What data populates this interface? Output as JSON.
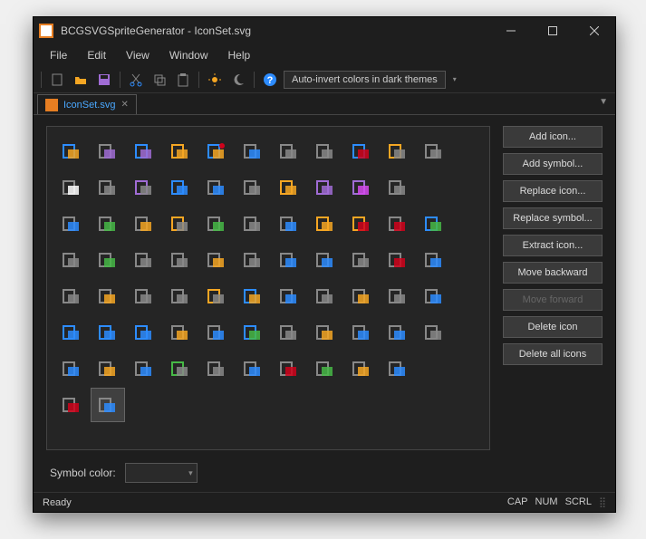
{
  "window": {
    "title": "BCGSVGSpriteGenerator - IconSet.svg"
  },
  "menubar": {
    "items": [
      "File",
      "Edit",
      "View",
      "Window",
      "Help"
    ]
  },
  "toolbar": {
    "auto_invert_label": "Auto-invert colors in dark themes"
  },
  "tab": {
    "label": "IconSet.svg"
  },
  "sidebar": {
    "buttons": [
      {
        "label": "Add icon...",
        "enabled": true
      },
      {
        "label": "Add symbol...",
        "enabled": true
      },
      {
        "label": "Replace icon...",
        "enabled": true
      },
      {
        "label": "Replace symbol...",
        "enabled": true
      },
      {
        "label": "Extract icon...",
        "enabled": true
      },
      {
        "label": "Move backward",
        "enabled": true
      },
      {
        "label": "Move forward",
        "enabled": false
      },
      {
        "label": "Delete icon",
        "enabled": true
      },
      {
        "label": "Delete all icons",
        "enabled": true
      }
    ]
  },
  "bottom": {
    "symbol_color_label": "Symbol color:"
  },
  "status": {
    "left": "Ready",
    "cap": "CAP",
    "num": "NUM",
    "scrl": "SCRL"
  },
  "icons": [
    {
      "name": "bar-chart",
      "c": [
        "#2d8cff",
        "#f5a623"
      ]
    },
    {
      "name": "chart-table",
      "c": [
        "#888",
        "#a06cd5"
      ]
    },
    {
      "name": "bars-arrow",
      "c": [
        "#2d8cff",
        "#a06cd5"
      ]
    },
    {
      "name": "sun",
      "c": [
        "#f5a623"
      ]
    },
    {
      "name": "pie-chart",
      "c": [
        "#2d8cff",
        "#f5a623",
        "#d0021b"
      ]
    },
    {
      "name": "image-resize",
      "c": [
        "#888",
        "#2d8cff"
      ]
    },
    {
      "name": "windows",
      "c": [
        "#888"
      ]
    },
    {
      "name": "align-left",
      "c": [
        "#888"
      ]
    },
    {
      "name": "font-a",
      "c": [
        "#2d8cff",
        "#d0021b"
      ]
    },
    {
      "name": "square-back",
      "c": [
        "#f5a623",
        "#888"
      ]
    },
    {
      "name": "squares",
      "c": [
        "#888"
      ]
    },
    {
      "name": "contrast",
      "c": [
        "#888",
        "#fff"
      ]
    },
    {
      "name": "sun-outline",
      "c": [
        "#888"
      ]
    },
    {
      "name": "disk-back",
      "c": [
        "#a06cd5",
        "#888"
      ]
    },
    {
      "name": "rotate",
      "c": [
        "#2d8cff"
      ]
    },
    {
      "name": "page-image",
      "c": [
        "#888",
        "#2d8cff"
      ]
    },
    {
      "name": "page",
      "c": [
        "#888"
      ]
    },
    {
      "name": "folder-open",
      "c": [
        "#f5a623"
      ]
    },
    {
      "name": "disk",
      "c": [
        "#a06cd5"
      ]
    },
    {
      "name": "disk-edit",
      "c": [
        "#a06cd5",
        "#d54aee"
      ]
    },
    {
      "name": "printer",
      "c": [
        "#888"
      ]
    },
    {
      "name": "blank1",
      "c": []
    },
    {
      "name": "page-edit",
      "c": [
        "#888",
        "#2d8cff"
      ]
    },
    {
      "name": "user-page",
      "c": [
        "#888",
        "#46b946"
      ]
    },
    {
      "name": "table-plus",
      "c": [
        "#888",
        "#f5a623"
      ]
    },
    {
      "name": "folder-up",
      "c": [
        "#f5a623",
        "#888"
      ]
    },
    {
      "name": "printer-check",
      "c": [
        "#888",
        "#46b946"
      ]
    },
    {
      "name": "page-search",
      "c": [
        "#888"
      ]
    },
    {
      "name": "page-info",
      "c": [
        "#888",
        "#2d8cff"
      ]
    },
    {
      "name": "page-lines",
      "c": [
        "#f5a623"
      ]
    },
    {
      "name": "lock",
      "c": [
        "#f5a623",
        "#d0021b"
      ]
    },
    {
      "name": "page-cert",
      "c": [
        "#888",
        "#d0021b"
      ]
    },
    {
      "name": "word-check",
      "c": [
        "#2d8cff",
        "#46b946"
      ]
    },
    {
      "name": "para-left",
      "c": [
        "#888"
      ]
    },
    {
      "name": "page-check",
      "c": [
        "#888",
        "#46b946"
      ]
    },
    {
      "name": "two-pages",
      "c": [
        "#888"
      ]
    },
    {
      "name": "page-wide",
      "c": [
        "#888"
      ]
    },
    {
      "name": "film",
      "c": [
        "#888",
        "#f5a623"
      ]
    },
    {
      "name": "page-x",
      "c": [
        "#888"
      ]
    },
    {
      "name": "cut",
      "c": [
        "#888",
        "#2d8cff"
      ]
    },
    {
      "name": "page-ruler",
      "c": [
        "#888",
        "#2d8cff"
      ]
    },
    {
      "name": "copy",
      "c": [
        "#888"
      ]
    },
    {
      "name": "edit-a",
      "c": [
        "#888",
        "#d0021b"
      ]
    },
    {
      "name": "back-front",
      "c": [
        "#888",
        "#2d8cff"
      ]
    },
    {
      "name": "page-text",
      "c": [
        "#888"
      ]
    },
    {
      "name": "page-text2",
      "c": [
        "#888",
        "#f5a623"
      ]
    },
    {
      "name": "overlap",
      "c": [
        "#888"
      ]
    },
    {
      "name": "bar-chart2",
      "c": [
        "#888"
      ]
    },
    {
      "name": "clipboard",
      "c": [
        "#f5a623",
        "#888"
      ]
    },
    {
      "name": "picture",
      "c": [
        "#2d8cff",
        "#f5a623"
      ]
    },
    {
      "name": "checkbox",
      "c": [
        "#888",
        "#2d8cff"
      ]
    },
    {
      "name": "page-lines2",
      "c": [
        "#888"
      ]
    },
    {
      "name": "page-star",
      "c": [
        "#888",
        "#f5a623"
      ]
    },
    {
      "name": "square-angle",
      "c": [
        "#888"
      ]
    },
    {
      "name": "search-box",
      "c": [
        "#888",
        "#2d8cff"
      ]
    },
    {
      "name": "arrow-right",
      "c": [
        "#2d8cff"
      ]
    },
    {
      "name": "arrow-left",
      "c": [
        "#2d8cff"
      ]
    },
    {
      "name": "arrow-down",
      "c": [
        "#2d8cff"
      ]
    },
    {
      "name": "page-lock",
      "c": [
        "#888",
        "#f5a623"
      ]
    },
    {
      "name": "half-page",
      "c": [
        "#888",
        "#2d8cff"
      ]
    },
    {
      "name": "abc-check",
      "c": [
        "#2d8cff",
        "#46b946"
      ]
    },
    {
      "name": "book",
      "c": [
        "#888"
      ]
    },
    {
      "name": "page-pencil",
      "c": [
        "#888",
        "#f5a623"
      ]
    },
    {
      "name": "translate",
      "c": [
        "#888",
        "#2d8cff"
      ]
    },
    {
      "name": "page-globe",
      "c": [
        "#888",
        "#2d8cff"
      ]
    },
    {
      "name": "magnifier",
      "c": [
        "#888"
      ]
    },
    {
      "name": "ruler-page",
      "c": [
        "#888",
        "#2d8cff"
      ]
    },
    {
      "name": "page-arrow",
      "c": [
        "#888",
        "#f5a623"
      ]
    },
    {
      "name": "windows2",
      "c": [
        "#888",
        "#2d8cff"
      ]
    },
    {
      "name": "user-green",
      "c": [
        "#46b946",
        "#888"
      ]
    },
    {
      "name": "table2",
      "c": [
        "#888"
      ]
    },
    {
      "name": "grid",
      "c": [
        "#888",
        "#2d8cff"
      ]
    },
    {
      "name": "ab1",
      "c": [
        "#888",
        "#d0021b"
      ]
    },
    {
      "name": "square-plus",
      "c": [
        "#888",
        "#46b946"
      ]
    },
    {
      "name": "portrait",
      "c": [
        "#888",
        "#f5a623"
      ]
    },
    {
      "name": "pages-arrow",
      "c": [
        "#888",
        "#2d8cff"
      ]
    },
    {
      "name": "blank2",
      "c": []
    },
    {
      "name": "page-down",
      "c": [
        "#888",
        "#d0021b"
      ]
    },
    {
      "name": "a-italic",
      "c": [
        "#888",
        "#2d8cff"
      ],
      "sel": true
    }
  ]
}
